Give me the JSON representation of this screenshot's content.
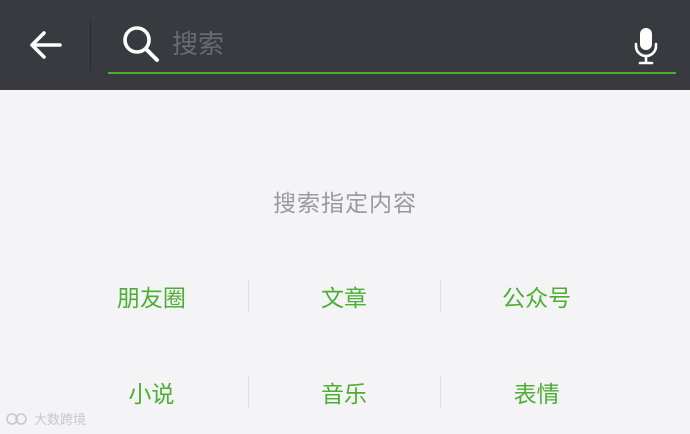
{
  "header": {
    "search_placeholder": "搜索",
    "search_value": "",
    "back_icon": "arrow-left-icon",
    "search_icon": "magnifier-icon",
    "mic_icon": "microphone-icon"
  },
  "colors": {
    "topbar": "#393a3f",
    "accent": "#4cae32",
    "background": "#f4f4f6",
    "hint_text": "#9a9a9c"
  },
  "hint": "搜索指定内容",
  "categories": {
    "row1": [
      "朋友圈",
      "文章",
      "公众号"
    ],
    "row2": [
      "小说",
      "音乐",
      "表情"
    ]
  },
  "watermark": "大数跨境"
}
